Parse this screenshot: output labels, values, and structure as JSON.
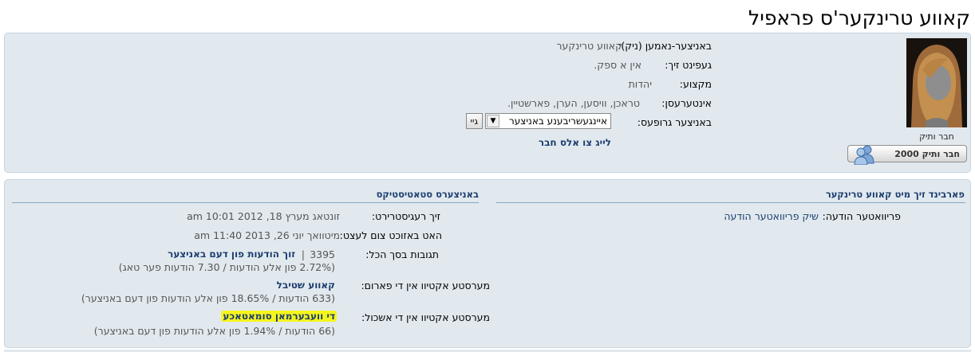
{
  "page": {
    "title": "קאווע טרינקער'ס פראפיל"
  },
  "user": {
    "rank_title": "חבר ותיק",
    "reputation": "חבר ותיק 2000"
  },
  "profile": {
    "fields": [
      {
        "label": "באניצער-נאמען (ניק):",
        "value": "קאווע טרינקער"
      },
      {
        "label": "געפינט זיך:",
        "value": "אין א ספק."
      },
      {
        "label": "מקצוע:",
        "value": "יהדות"
      },
      {
        "label": "אינטערעסן:",
        "value": "טראכן, וויסען, הערן, פארשטיין."
      }
    ],
    "groups_label": "באניצער גרופעס:",
    "groups_select": "איינגעשריבענע באניצער",
    "go_label": "גיי",
    "add_friend": "לייג צו אלס חבר"
  },
  "contact": {
    "header": "פארבינד זיך מיט קאווע טרינקער",
    "pm_label": "פריוואטער הודעה:",
    "pm_link": "שיק פריוואטער הודעה"
  },
  "stats": {
    "header": "באניצערס סטאטיסטיקס",
    "registered_label": "זיך רעגיסטרירט:",
    "registered_value": "זונטאג מערץ 18, 2012 10:01 am",
    "lastvisit_label": "האט באזוכט צום לעצט:",
    "lastvisit_value": "מיטוואך יוני 26, 2013 11:40 am",
    "posts_label": "תגובות בסך הכל:",
    "posts_count": "3395",
    "posts_sep": "|",
    "posts_link": "זוך הודעות פון דעם באניצער",
    "posts_detail": "(2.72% פון אלע הודעות / 7.30 הודעות פער טאג)",
    "active_forum_label": "מערסטע אקטיוו אין די פארום:",
    "active_forum_link": "קאווע שטיבל",
    "active_forum_detail": "(633 הודעות / 18.65% פון אלע הודעות פון דעם באניצער)",
    "active_topic_label": "מערסטע אקטיוו אין די אשכול:",
    "active_topic_link": "די וועבערמאן סומאטאכע",
    "active_topic_detail": "(66 הודעות / 1.94% פון אלע הודעות פון דעם באניצער)"
  },
  "colors": {
    "panel_bg": "#e1e9ef",
    "link": "#1c3d6e",
    "highlight": "#f5f51e"
  },
  "icons": {
    "reputation": "users-icon",
    "select_arrow": "dropdown-arrow-icon"
  }
}
